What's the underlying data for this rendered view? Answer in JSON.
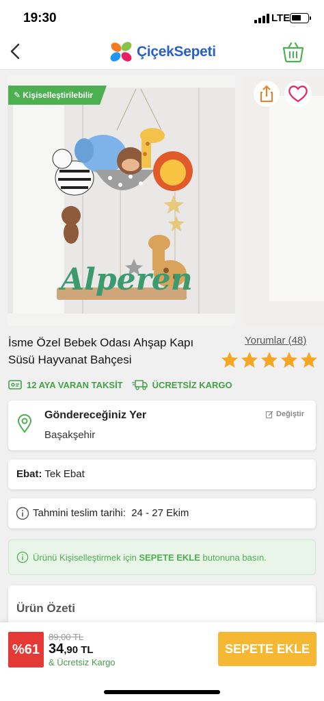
{
  "status_bar": {
    "time": "19:30",
    "network": "LTE"
  },
  "header": {
    "logo_text": "ÇiçekSepeti",
    "back_icon": "chevron-left-icon",
    "basket_icon": "basket-icon"
  },
  "gallery": {
    "badge": "Kişiselleştirilebilir",
    "main_art_text": "Alperen"
  },
  "product": {
    "title": "İsme Özel Bebek Odası Ahşap Kapı Süsü Hayvanat Bahçesi",
    "reviews": "Yorumlar (48)",
    "rating_stars": 5
  },
  "perks": {
    "installment": "12 AYA VARAN TAKSİT",
    "cargo": "ÜCRETSİZ KARGO"
  },
  "address": {
    "title": "Göndereceğiniz Yer",
    "value": "Başakşehir",
    "change_label": "Değiştir"
  },
  "size": {
    "label": "Ebat:",
    "value": "Tek Ebat"
  },
  "delivery": {
    "label": "Tahmini teslim tarihi:",
    "value": "24 - 27 Ekim"
  },
  "notice": {
    "prefix": "Ürünü Kişiselleştirmek için",
    "highlight": "SEPETE EKLE",
    "suffix": "butonuna basın."
  },
  "summary": {
    "title": "Ürün Özeti"
  },
  "price": {
    "discount": "%61",
    "old": "89,00 TL",
    "new_major": "34",
    "new_minor": ",90 TL",
    "cargo_note": "& Ücretsiz Kargo"
  },
  "cta": {
    "label": "SEPETE EKLE"
  },
  "colors": {
    "brand_blue": "#2860c4",
    "green": "#4caf50",
    "discount_red": "#e53935",
    "cta_yellow": "#f6b733",
    "star": "#f5a623"
  }
}
